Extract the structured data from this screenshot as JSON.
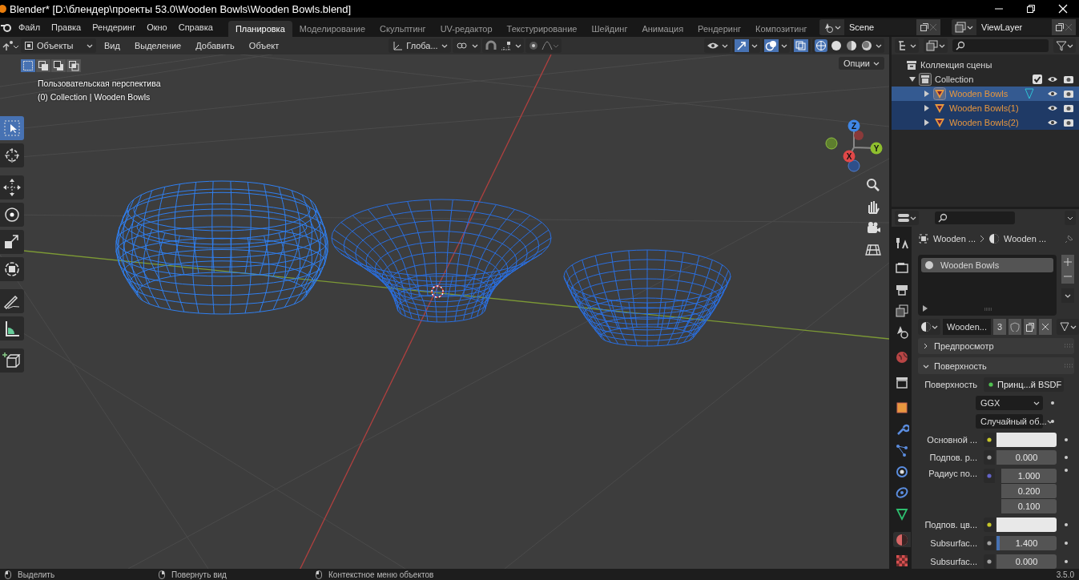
{
  "window": {
    "title": "Blender* [D:\\блендер\\проекты 53.0\\Wooden Bowls\\Wooden Bowls.blend]"
  },
  "menu": [
    "Файл",
    "Правка",
    "Рендеринг",
    "Окно",
    "Справка"
  ],
  "workspaces": [
    {
      "label": "Планировка",
      "selected": true
    },
    {
      "label": "Моделирование",
      "selected": false
    },
    {
      "label": "Скульптинг",
      "selected": false
    },
    {
      "label": "UV-редактор",
      "selected": false
    },
    {
      "label": "Текстурирование",
      "selected": false
    },
    {
      "label": "Шейдинг",
      "selected": false
    },
    {
      "label": "Анимация",
      "selected": false
    },
    {
      "label": "Рендеринг",
      "selected": false
    },
    {
      "label": "Композитинг",
      "selected": false
    }
  ],
  "scene": {
    "name": "Scene"
  },
  "view_layer": {
    "name": "ViewLayer"
  },
  "viewport": {
    "mode": "Объекты",
    "menu": [
      "Вид",
      "Выделение",
      "Добавить",
      "Объект"
    ],
    "orientation": "Глоба...",
    "options": "Опции",
    "view_name": "Пользовательская перспектива",
    "context": "(0) Collection | Wooden Bowls",
    "select_modes": [
      {
        "kind": "set",
        "selected": true
      },
      {
        "kind": "extend",
        "selected": false
      },
      {
        "kind": "subtract",
        "selected": false
      },
      {
        "kind": "intersect",
        "selected": false
      }
    ],
    "tools": [
      {
        "kind": "select",
        "selected": true
      },
      {
        "kind": "cursor",
        "selected": false
      },
      {
        "kind": "move",
        "selected": false
      },
      {
        "kind": "rotate",
        "selected": false
      },
      {
        "kind": "scale",
        "selected": false
      },
      {
        "kind": "transform",
        "selected": false
      },
      {
        "kind": "annotate",
        "selected": false
      },
      {
        "kind": "measure",
        "selected": false
      },
      {
        "kind": "add-cube",
        "selected": false
      }
    ],
    "gizmo_axes": [
      "Z",
      "Y",
      "X"
    ]
  },
  "outliner": {
    "root": "Коллекция сцены",
    "collection": {
      "name": "Collection",
      "expanded": true,
      "checked": true,
      "children": [
        {
          "name": "Wooden Bowls",
          "selected": true,
          "active": true
        },
        {
          "name": "Wooden Bowls(1)",
          "selected": true,
          "active": false
        },
        {
          "name": "Wooden Bowls(2)",
          "selected": true,
          "active": false
        }
      ]
    }
  },
  "properties": {
    "tabs": [
      {
        "kind": "tool",
        "selected": false
      },
      {
        "kind": "render",
        "selected": false
      },
      {
        "kind": "output",
        "selected": false
      },
      {
        "kind": "view-layer",
        "selected": false
      },
      {
        "kind": "scene",
        "selected": false
      },
      {
        "kind": "world",
        "selected": false
      },
      {
        "kind": "collection",
        "selected": false
      },
      {
        "kind": "object",
        "selected": false
      },
      {
        "kind": "modifiers",
        "selected": false
      },
      {
        "kind": "particles",
        "selected": false
      },
      {
        "kind": "physics",
        "selected": false
      },
      {
        "kind": "constraints",
        "selected": false
      },
      {
        "kind": "data",
        "selected": false
      },
      {
        "kind": "material",
        "selected": true
      },
      {
        "kind": "texture",
        "selected": false
      }
    ],
    "breadcrumb": [
      "Wooden ...",
      "Wooden ..."
    ],
    "material_slots": [
      {
        "name": "Wooden Bowls",
        "selected": true
      }
    ],
    "material": {
      "name": "Wooden...",
      "users": "3"
    },
    "panels": [
      {
        "label": "Предпросмотр",
        "expanded": false
      },
      {
        "label": "Поверхность",
        "expanded": true
      }
    ],
    "fields": [
      {
        "kind": "shader",
        "label": "Поверхность",
        "value": "Принц...й BSDF",
        "color": "#4fbf4f"
      },
      {
        "kind": "dropdown",
        "value": "GGX"
      },
      {
        "kind": "dropdown",
        "value": "Случайный об..."
      },
      {
        "kind": "color",
        "label": "Основной ...",
        "color": "#c7c729"
      },
      {
        "kind": "number",
        "label": "Подпов. р...",
        "value": "0.000",
        "color": "#a1a1a1"
      },
      {
        "kind": "vector",
        "label": "Радиус по...",
        "values": [
          "1.000",
          "0.200",
          "0.100"
        ],
        "color": "#6363c7"
      },
      {
        "kind": "color",
        "label": "Подпов. цв...",
        "color": "#c7c729"
      },
      {
        "kind": "slider",
        "label": "Subsurfac...",
        "value": "1.400",
        "level": 0.05,
        "color": "#a1a1a1"
      },
      {
        "kind": "number",
        "label": "Subsurfac...",
        "value": "0.000",
        "color": "#a1a1a1"
      }
    ]
  },
  "status": {
    "hints": [
      "Выделить",
      "Повернуть вид",
      "Контекстное меню объектов"
    ],
    "version": "3.5.0"
  }
}
